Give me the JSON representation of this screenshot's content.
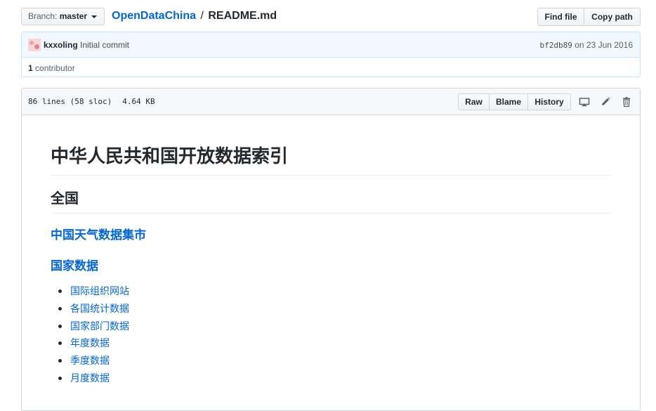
{
  "topbar": {
    "branch_label": "Branch:",
    "branch_value": "master",
    "repo": "OpenDataChina",
    "separator": "/",
    "file": "README.md",
    "find_file": "Find file",
    "copy_path": "Copy path"
  },
  "commit": {
    "author": "kxxoling",
    "message": "Initial commit",
    "sha": "bf2db89",
    "date": "on 23 Jun 2016",
    "contributor_count": "1",
    "contributor_label": "contributor"
  },
  "file": {
    "lines": "86 lines (58 sloc)",
    "size": "4.64 KB",
    "raw": "Raw",
    "blame": "Blame",
    "history": "History"
  },
  "readme": {
    "h1": "中华人民共和国开放数据索引",
    "h2": "全国",
    "h3_a": "中国天气数据集市",
    "h3_b": "国家数据",
    "items": [
      "国际组织网站",
      "各国统计数据",
      "国家部门数据",
      "年度数据",
      "季度数据",
      "月度数据"
    ]
  },
  "colors": {
    "link": "#0366d6",
    "commit_bg": "#f1f8ff",
    "commit_border": "#c8e1ff",
    "header_bg": "#f6f8fa"
  },
  "icons": [
    "caret-down-icon",
    "desktop-icon",
    "pencil-icon",
    "trash-icon"
  ]
}
